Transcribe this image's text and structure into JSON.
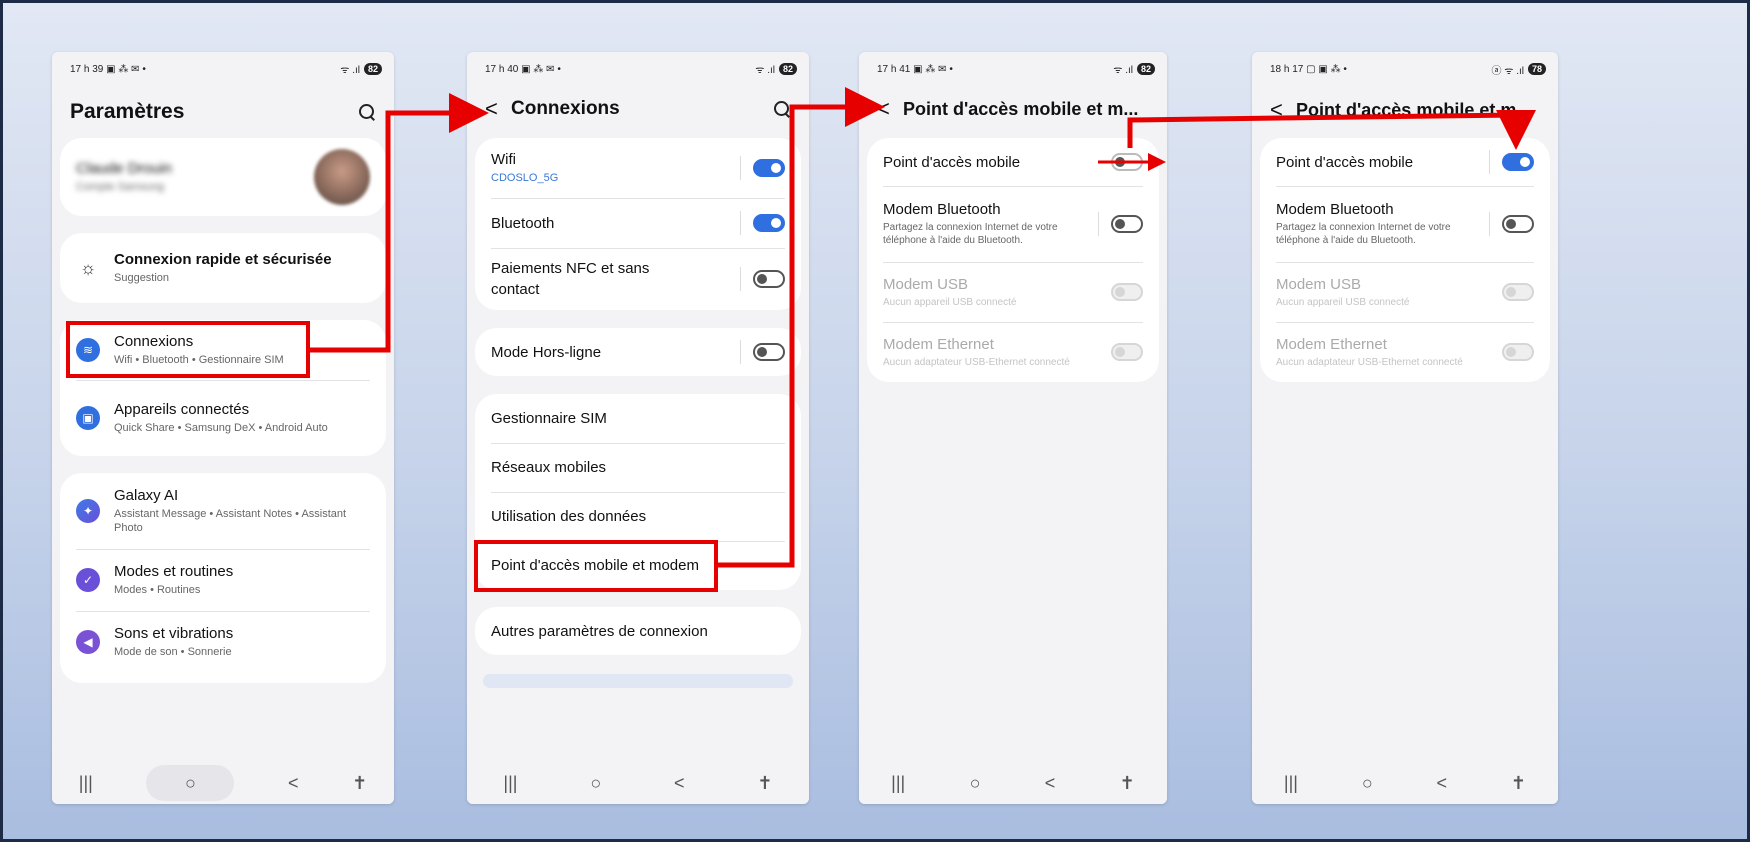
{
  "colors": {
    "accent": "#2f6fe0",
    "arrow": "#e60000",
    "border": "#1d2b47"
  },
  "phones": [
    {
      "status": {
        "time": "17 h 39",
        "icons": "▣ ⁂ ✉ •",
        "signal": "ᯤ .ıl",
        "battery": "82"
      },
      "title": "Paramètres",
      "profile": {
        "name": "Claude Drouin",
        "sub": "Compte Samsung"
      },
      "quick": {
        "label": "Connexion rapide et sécurisée",
        "sub": "Suggestion"
      },
      "items": [
        {
          "label": "Connexions",
          "sub": "Wifi • Bluetooth • Gestionnaire SIM"
        },
        {
          "label": "Appareils connectés",
          "sub": "Quick Share • Samsung DeX • Android Auto"
        },
        {
          "label": "Galaxy AI",
          "sub": "Assistant Message • Assistant Notes • Assistant Photo"
        },
        {
          "label": "Modes et routines",
          "sub": "Modes • Routines"
        },
        {
          "label": "Sons et vibrations",
          "sub": "Mode de son • Sonnerie"
        }
      ]
    },
    {
      "status": {
        "time": "17 h 40",
        "icons": "▣ ⁂ ✉ •",
        "signal": "ᯤ .ıl",
        "battery": "82"
      },
      "back": "<",
      "title": "Connexions",
      "group1": [
        {
          "label": "Wifi",
          "sub": "CDOSLO_5G",
          "state": "on"
        },
        {
          "label": "Bluetooth",
          "state": "on"
        },
        {
          "label": "Paiements NFC et sans contact",
          "state": "off"
        }
      ],
      "airplane": {
        "label": "Mode Hors-ligne",
        "state": "off"
      },
      "group3": [
        {
          "label": "Gestionnaire SIM"
        },
        {
          "label": "Réseaux mobiles"
        },
        {
          "label": "Utilisation des données"
        },
        {
          "label": "Point d'accès mobile et modem"
        }
      ],
      "other": {
        "label": "Autres paramètres de connexion"
      }
    },
    {
      "status": {
        "time": "17 h 41",
        "icons": "▣ ⁂ ✉ •",
        "signal": "ᯤ .ıl",
        "battery": "82"
      },
      "back": "<",
      "title": "Point d'accès mobile et m...",
      "items": [
        {
          "label": "Point d'accès mobile",
          "state": "off"
        },
        {
          "label": "Modem Bluetooth",
          "sub": "Partagez la connexion Internet de votre téléphone à l'aide du Bluetooth.",
          "state": "off"
        },
        {
          "label": "Modem USB",
          "sub": "Aucun appareil USB connecté",
          "state": "disabled"
        },
        {
          "label": "Modem Ethernet",
          "sub": "Aucun adaptateur USB-Ethernet connecté",
          "state": "disabled"
        }
      ]
    },
    {
      "status": {
        "time": "18 h 17",
        "icons": "▢ ▣ ⁂ •",
        "signal": "ⓐ ᯤ .ıl",
        "battery": "78"
      },
      "back": "<",
      "title": "Point d'accès mobile et m...",
      "items": [
        {
          "label": "Point d'accès mobile",
          "state": "on"
        },
        {
          "label": "Modem Bluetooth",
          "sub": "Partagez la connexion Internet de votre téléphone à l'aide du Bluetooth.",
          "state": "off"
        },
        {
          "label": "Modem USB",
          "sub": "Aucun appareil USB connecté",
          "state": "disabled"
        },
        {
          "label": "Modem Ethernet",
          "sub": "Aucun adaptateur USB-Ethernet connecté",
          "state": "disabled"
        }
      ]
    }
  ],
  "nav": {
    "recents": "|||",
    "home": "○",
    "back": "<",
    "accessibility": "✝"
  }
}
